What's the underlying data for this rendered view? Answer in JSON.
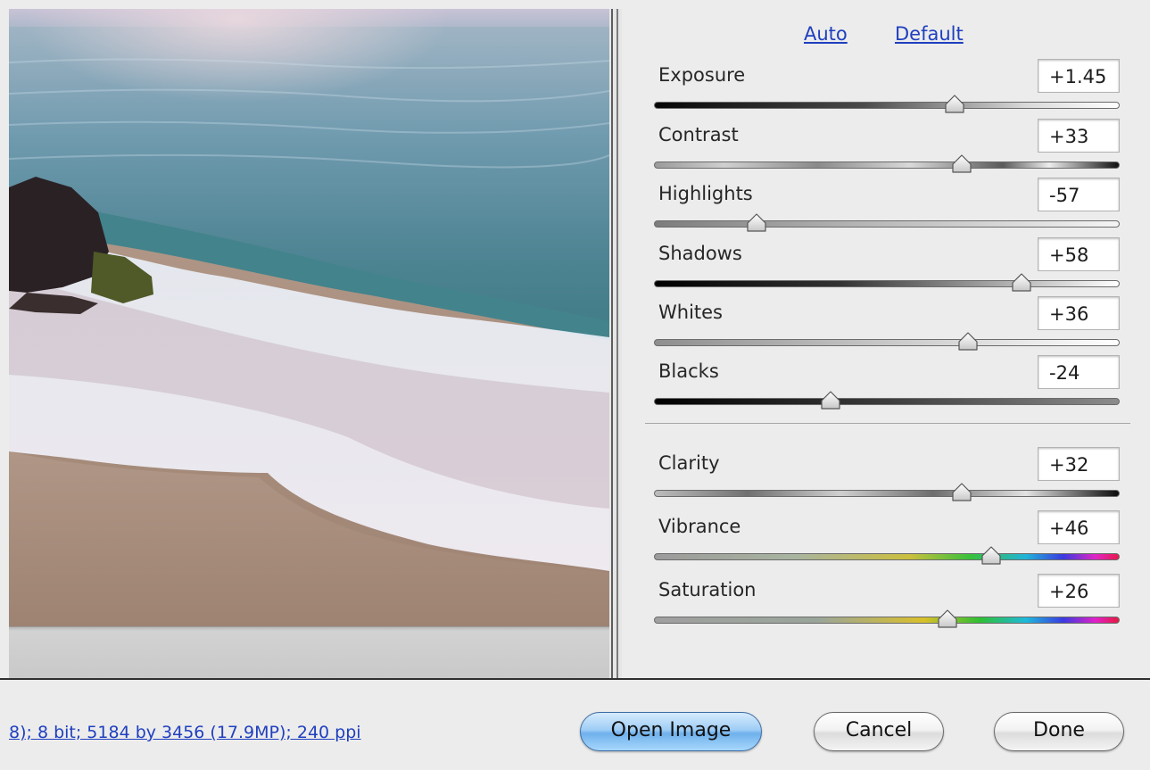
{
  "links": {
    "auto": "Auto",
    "default": "Default"
  },
  "sliders": [
    {
      "id": "exposure",
      "label": "Exposure",
      "value": "+1.45",
      "position": 0.645
    },
    {
      "id": "contrast",
      "label": "Contrast",
      "value": "+33",
      "position": 0.66
    },
    {
      "id": "highlights",
      "label": "Highlights",
      "value": "-57",
      "position": 0.22
    },
    {
      "id": "shadows",
      "label": "Shadows",
      "value": "+58",
      "position": 0.79
    },
    {
      "id": "whites",
      "label": "Whites",
      "value": "+36",
      "position": 0.675
    },
    {
      "id": "blacks",
      "label": "Blacks",
      "value": "-24",
      "position": 0.38
    },
    {
      "id": "clarity",
      "label": "Clarity",
      "value": "+32",
      "position": 0.66
    },
    {
      "id": "vibrance",
      "label": "Vibrance",
      "value": "+46",
      "position": 0.725
    },
    {
      "id": "saturation",
      "label": "Saturation",
      "value": "+26",
      "position": 0.63
    }
  ],
  "footer": {
    "info": "8); 8 bit; 5184 by 3456 (17.9MP); 240 ppi",
    "open_image": "Open Image",
    "cancel": "Cancel",
    "done": "Done"
  },
  "colors": {
    "link": "#1f3fbf",
    "primary_button": "#7ab8ef"
  }
}
